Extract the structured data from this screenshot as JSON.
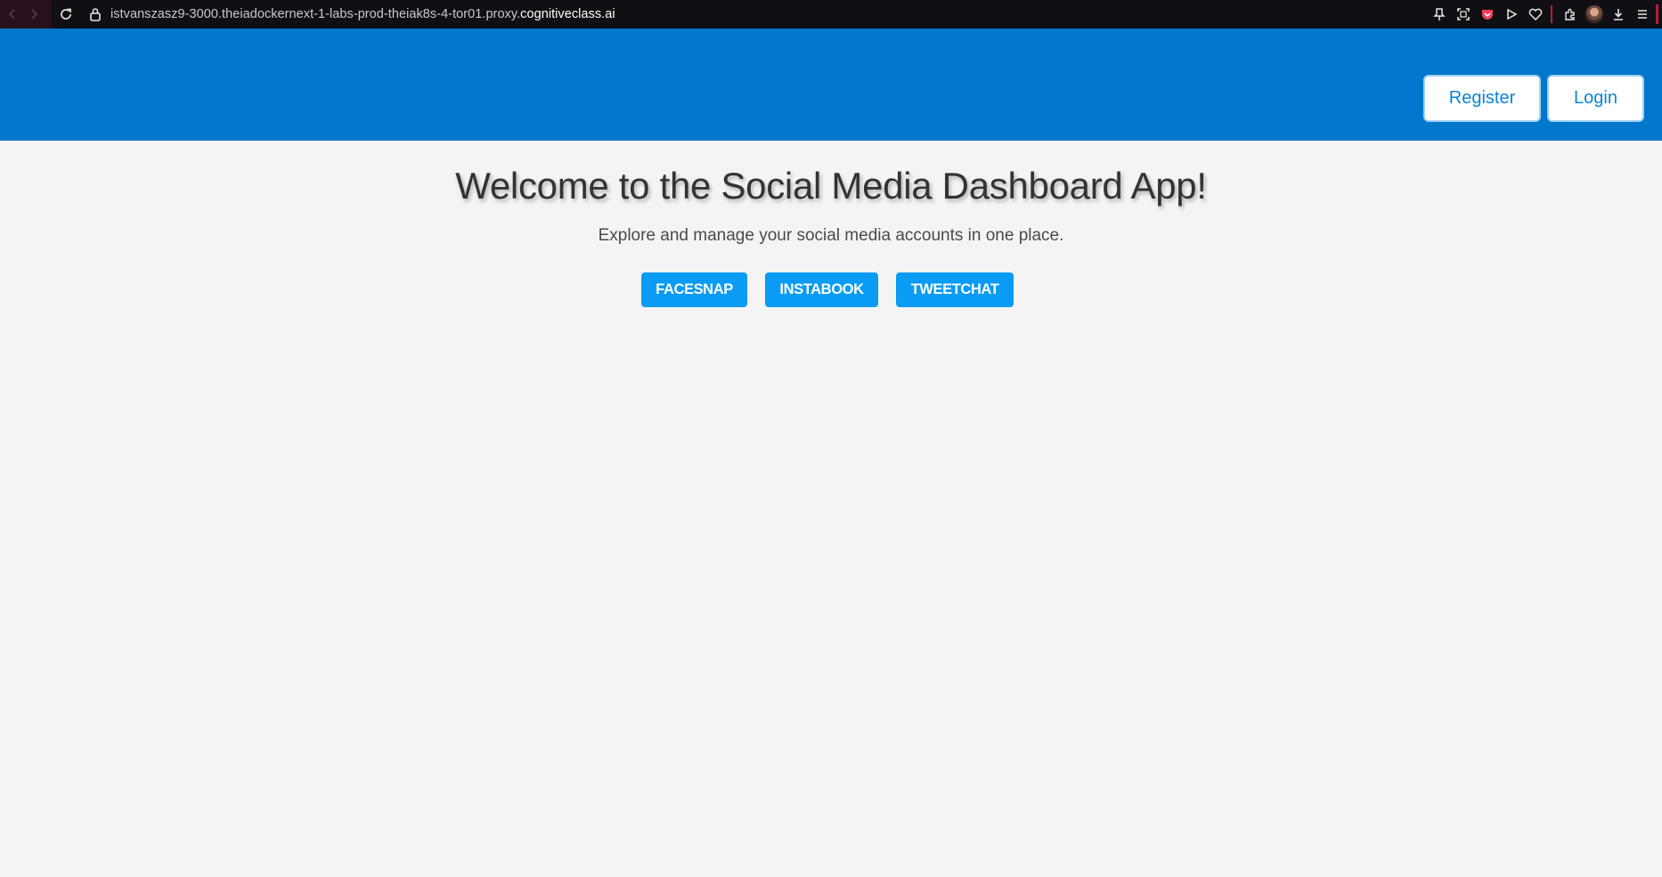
{
  "browser": {
    "url_prefix": "istvanszasz9-3000.theiadockernext-1-labs-prod-theiak8s-4-tor01.proxy.",
    "url_domain": "cognitiveclass.ai",
    "toolbar_icons": [
      "pin-icon",
      "screenshot-icon",
      "pocket-icon",
      "play-icon",
      "heart-icon",
      "extensions-icon",
      "avatar",
      "download-icon",
      "menu-icon"
    ]
  },
  "header": {
    "register_label": "Register",
    "login_label": "Login"
  },
  "main": {
    "title": "Welcome to the Social Media Dashboard App!",
    "subtitle": "Explore and manage your social media accounts in one place.",
    "platforms": [
      {
        "label": "FACESNAP"
      },
      {
        "label": "INSTABOOK"
      },
      {
        "label": "TWEETCHAT"
      }
    ]
  },
  "colors": {
    "header_bg": "#0077cc",
    "page_bg": "#f4f4f4",
    "platform_button_bg": "#0a9bf5",
    "header_button_text": "#0b84d6"
  }
}
